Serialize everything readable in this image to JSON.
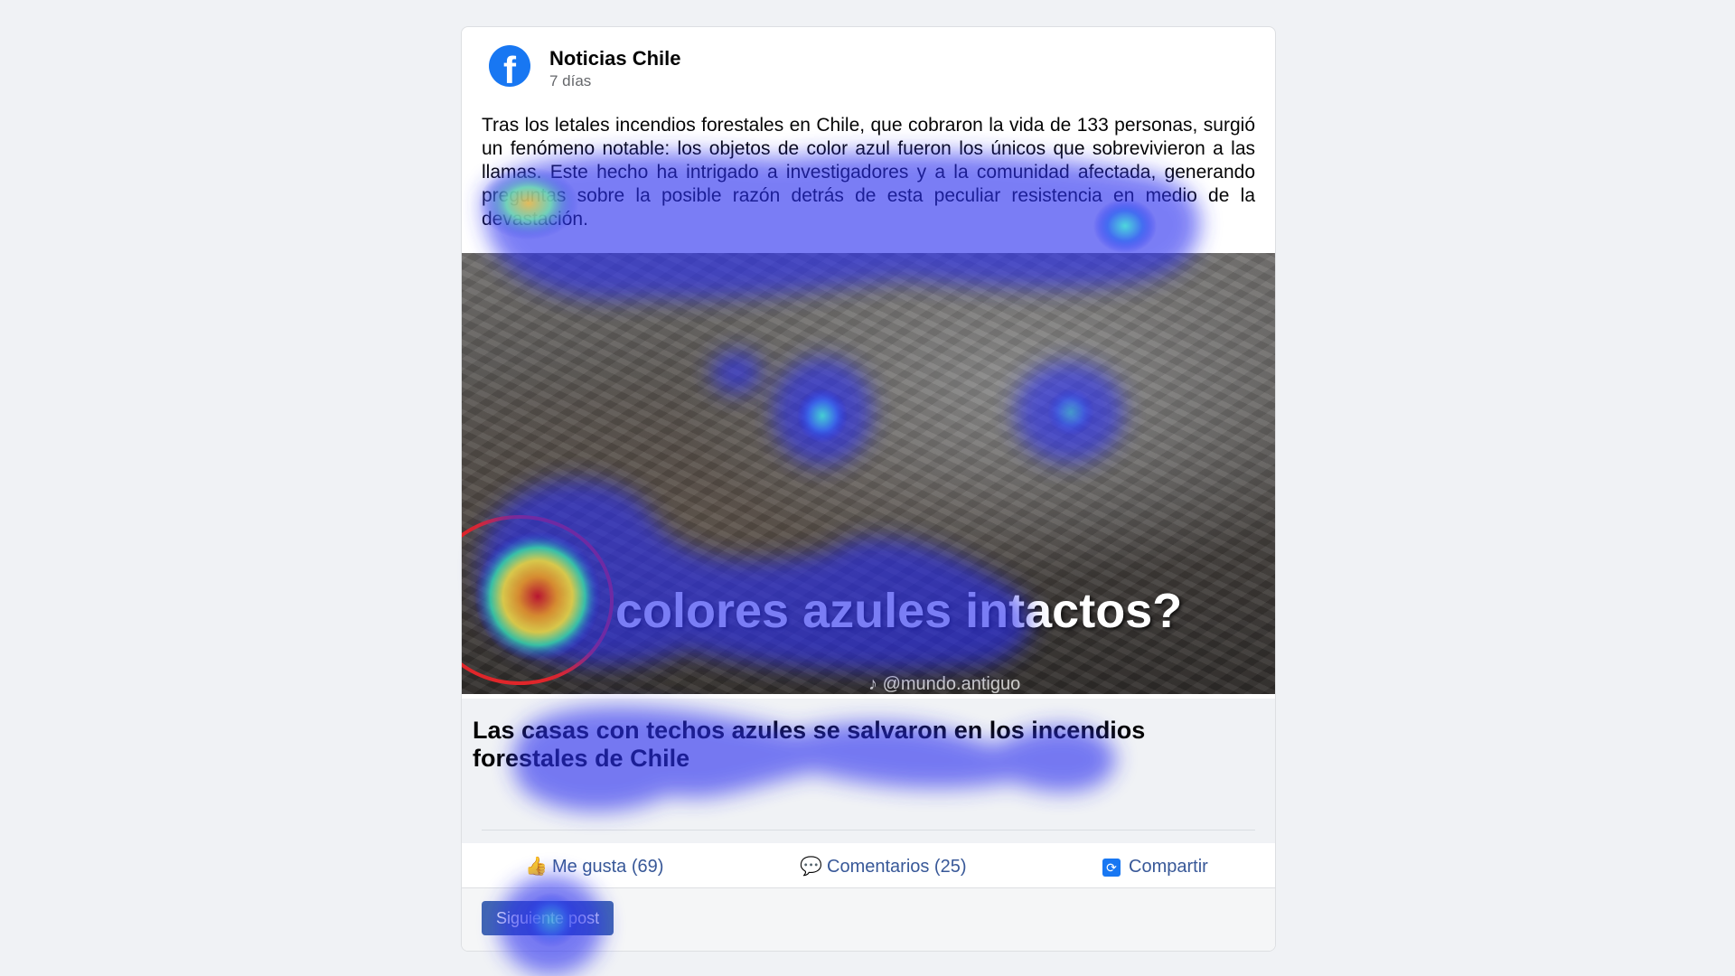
{
  "post": {
    "page_name": "Noticias Chile",
    "timestamp": "7 días",
    "logo_icon": "facebook-icon",
    "body_text": "Tras los letales incendios forestales en Chile, que cobraron la vida de 133 personas, surgió un fenómeno notable: los objetos de color azul fueron los únicos que sobrevivieron a las llamas. Este hecho ha intrigado a investigadores y a la comunidad afectada, generando preguntas sobre la posible razón detrás de esta peculiar resistencia en medio de la devastación.",
    "image": {
      "overlay_caption": "colores azules intactos?",
      "watermark": "@mundo.antiguo"
    },
    "link_title": "Las casas con techos azules se salvaron en los incendios forestales de Chile"
  },
  "actions": {
    "like_label": "Me gusta (69)",
    "comment_label": "Comentarios (25)",
    "share_label": "Compartir",
    "like_icon": "thumbs-up-icon",
    "comment_icon": "speech-bubble-icon",
    "share_icon": "share-icon"
  },
  "footer": {
    "next_button_label": "Siguiente post"
  },
  "colors": {
    "background": "#f0f2f5",
    "brand": "#1877f2",
    "action_text": "#385898",
    "button": "#4267b2"
  }
}
